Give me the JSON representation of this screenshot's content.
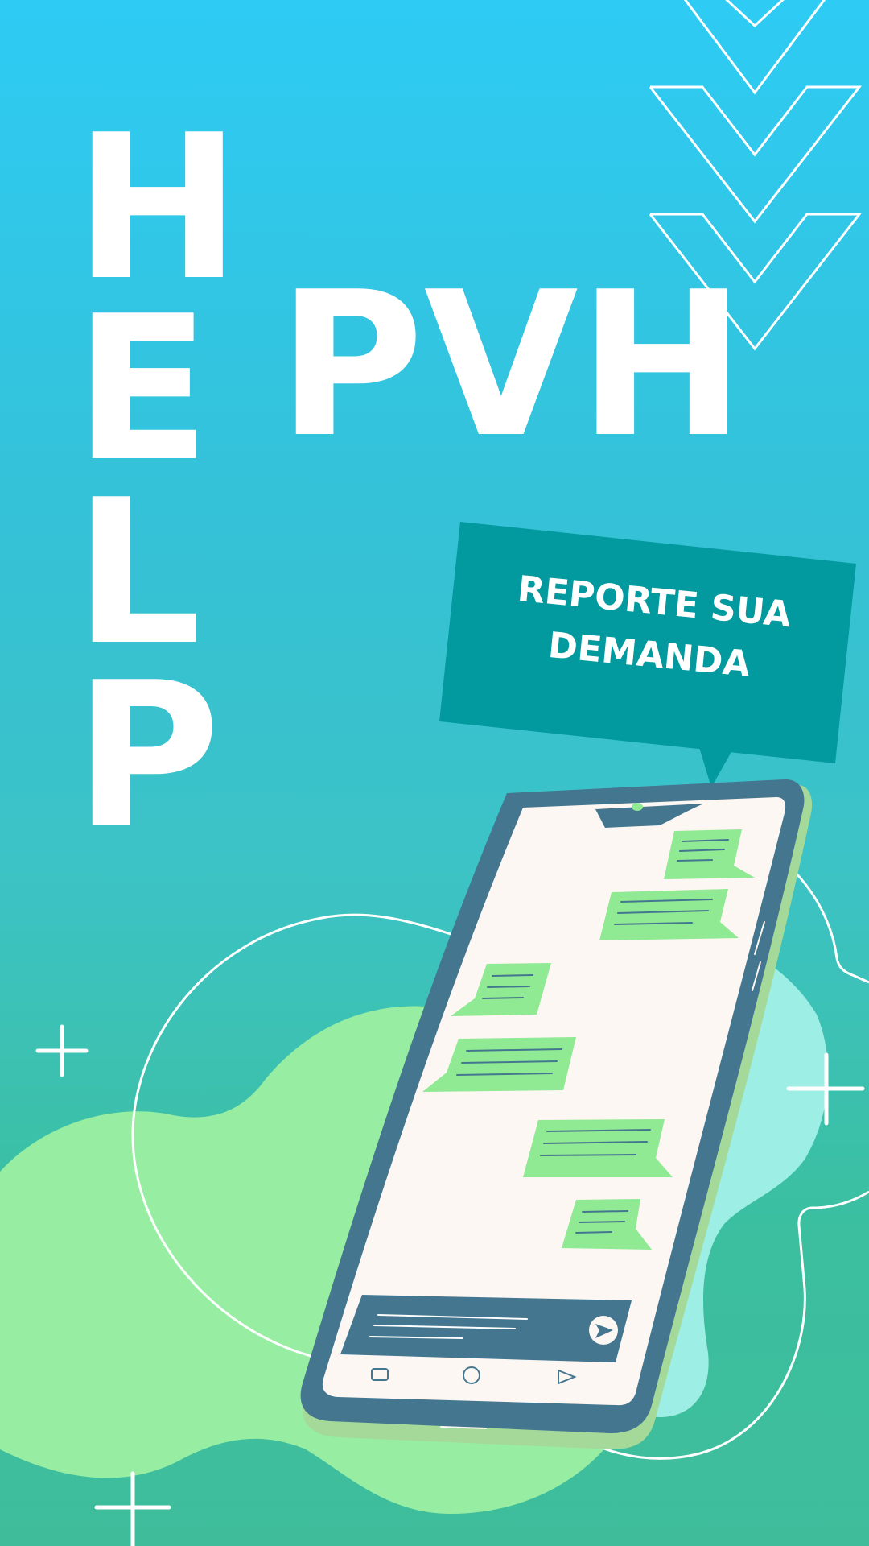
{
  "poster": {
    "help_letters": [
      "H",
      "E",
      "L",
      "P"
    ],
    "headline": "PVH",
    "bubble_line1": "REPORTE SUA",
    "bubble_line2": "DEMANDA"
  },
  "colors": {
    "background_top": "#2ecbf4",
    "background_bottom": "#3fbd9b",
    "bubble": "#039a9f",
    "phone_frame": "#447690",
    "phone_screen": "#fcf7f2",
    "chat_bubble": "#90e993",
    "blob_green": "#97eea2",
    "blob_aqua": "#9deee4",
    "text": "#ffffff"
  },
  "icons": [
    "chevron-down-icon",
    "plus-icon",
    "send-icon",
    "back-icon",
    "home-icon",
    "recent-apps-icon"
  ]
}
